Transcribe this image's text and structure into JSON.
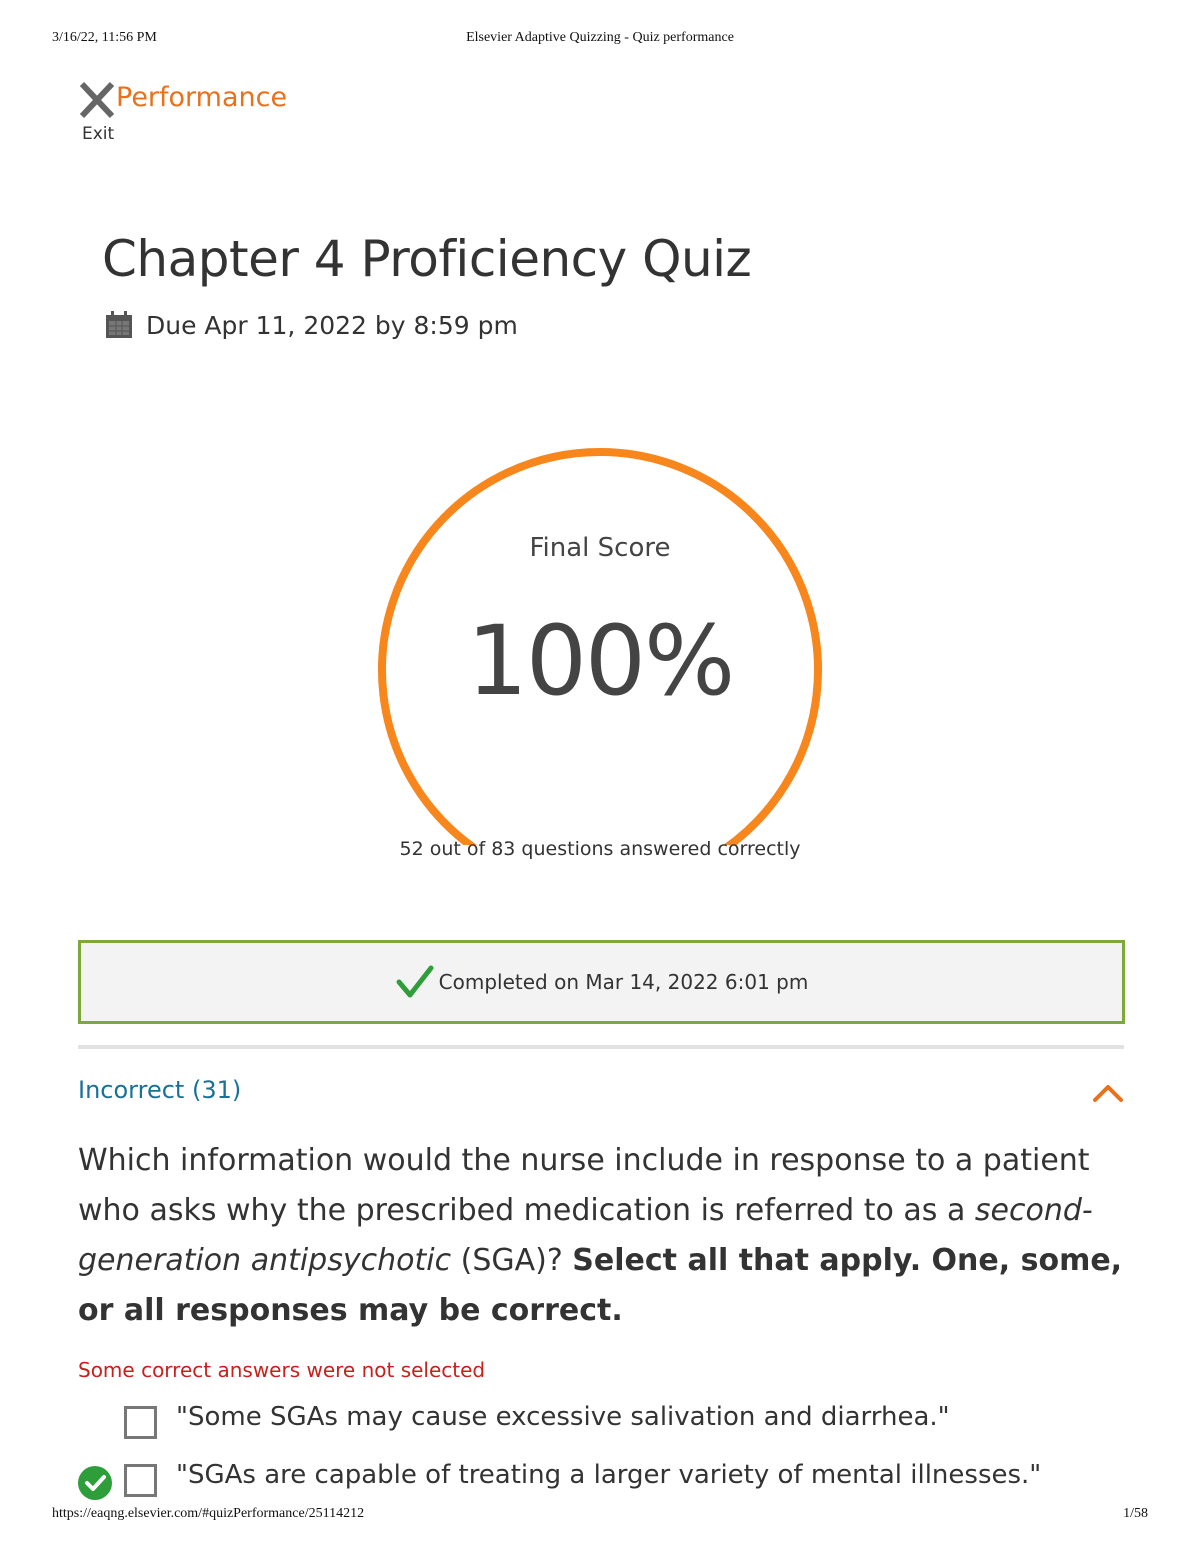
{
  "print_header": {
    "datetime": "3/16/22, 11:56 PM",
    "page_title": "Elsevier Adaptive Quizzing - Quiz performance"
  },
  "print_footer": {
    "url": "https://eaqng.elsevier.com/#quizPerformance/25114212",
    "page_number": "1/58"
  },
  "topbar": {
    "exit_label": "Exit",
    "title": "Performance",
    "accent_color": "#e9711c"
  },
  "quiz": {
    "title": "Chapter 4 Proficiency Quiz",
    "due": "Due Apr 11, 2022 by 8:59 pm"
  },
  "score": {
    "label": "Final Score",
    "value": "100%",
    "fraction": 1.0,
    "caption": "52 out of 83 questions answered correctly",
    "gauge_color": "#f7861c"
  },
  "completed": {
    "text": "Completed on Mar 14, 2022 6:01 pm",
    "border_color": "#7ea83a"
  },
  "incorrect_section": {
    "label": "Incorrect (31)",
    "expanded": true
  },
  "question": {
    "part1": "Which information would the nurse include in response to a patient who asks why the prescribed medication is referred to as a ",
    "italic": "second-generation antipsychotic",
    "part2": " (SGA)? ",
    "bold": "Select all that apply. One, some, or all responses may be correct.",
    "status": "Some correct answers were not selected",
    "answers": [
      {
        "text": "\"Some SGAs may cause excessive salivation and diarrhea.\"",
        "checked": false,
        "correct": false
      },
      {
        "text": "\"SGAs are capable of treating a larger variety of mental illnesses.\"",
        "checked": false,
        "correct": true
      }
    ]
  }
}
